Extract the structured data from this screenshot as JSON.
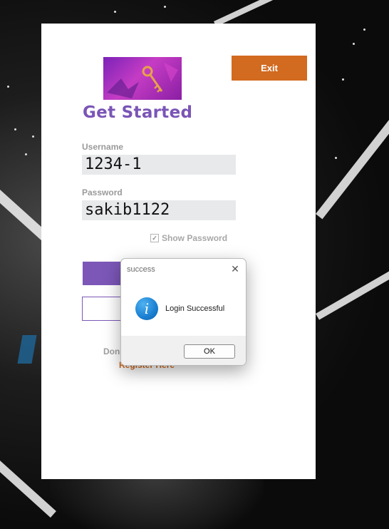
{
  "login_form": {
    "exit_label": "Exit",
    "title": "Get Started",
    "username_label": "Username",
    "username_value": "1234-1",
    "password_label": "Password",
    "password_value": "sakib1122",
    "show_password_label": "Show Password",
    "show_password_checked": true,
    "login_button_label": "",
    "register_button_label": "",
    "no_account_text": "Don",
    "register_link_text": "Register Here"
  },
  "dialog": {
    "title": "success",
    "message": "Login Successful",
    "ok_label": "OK",
    "icon": "info-icon"
  },
  "colors": {
    "accent_purple": "#7c57b8",
    "accent_orange": "#d26a1f",
    "info_blue": "#1a7fd1"
  }
}
